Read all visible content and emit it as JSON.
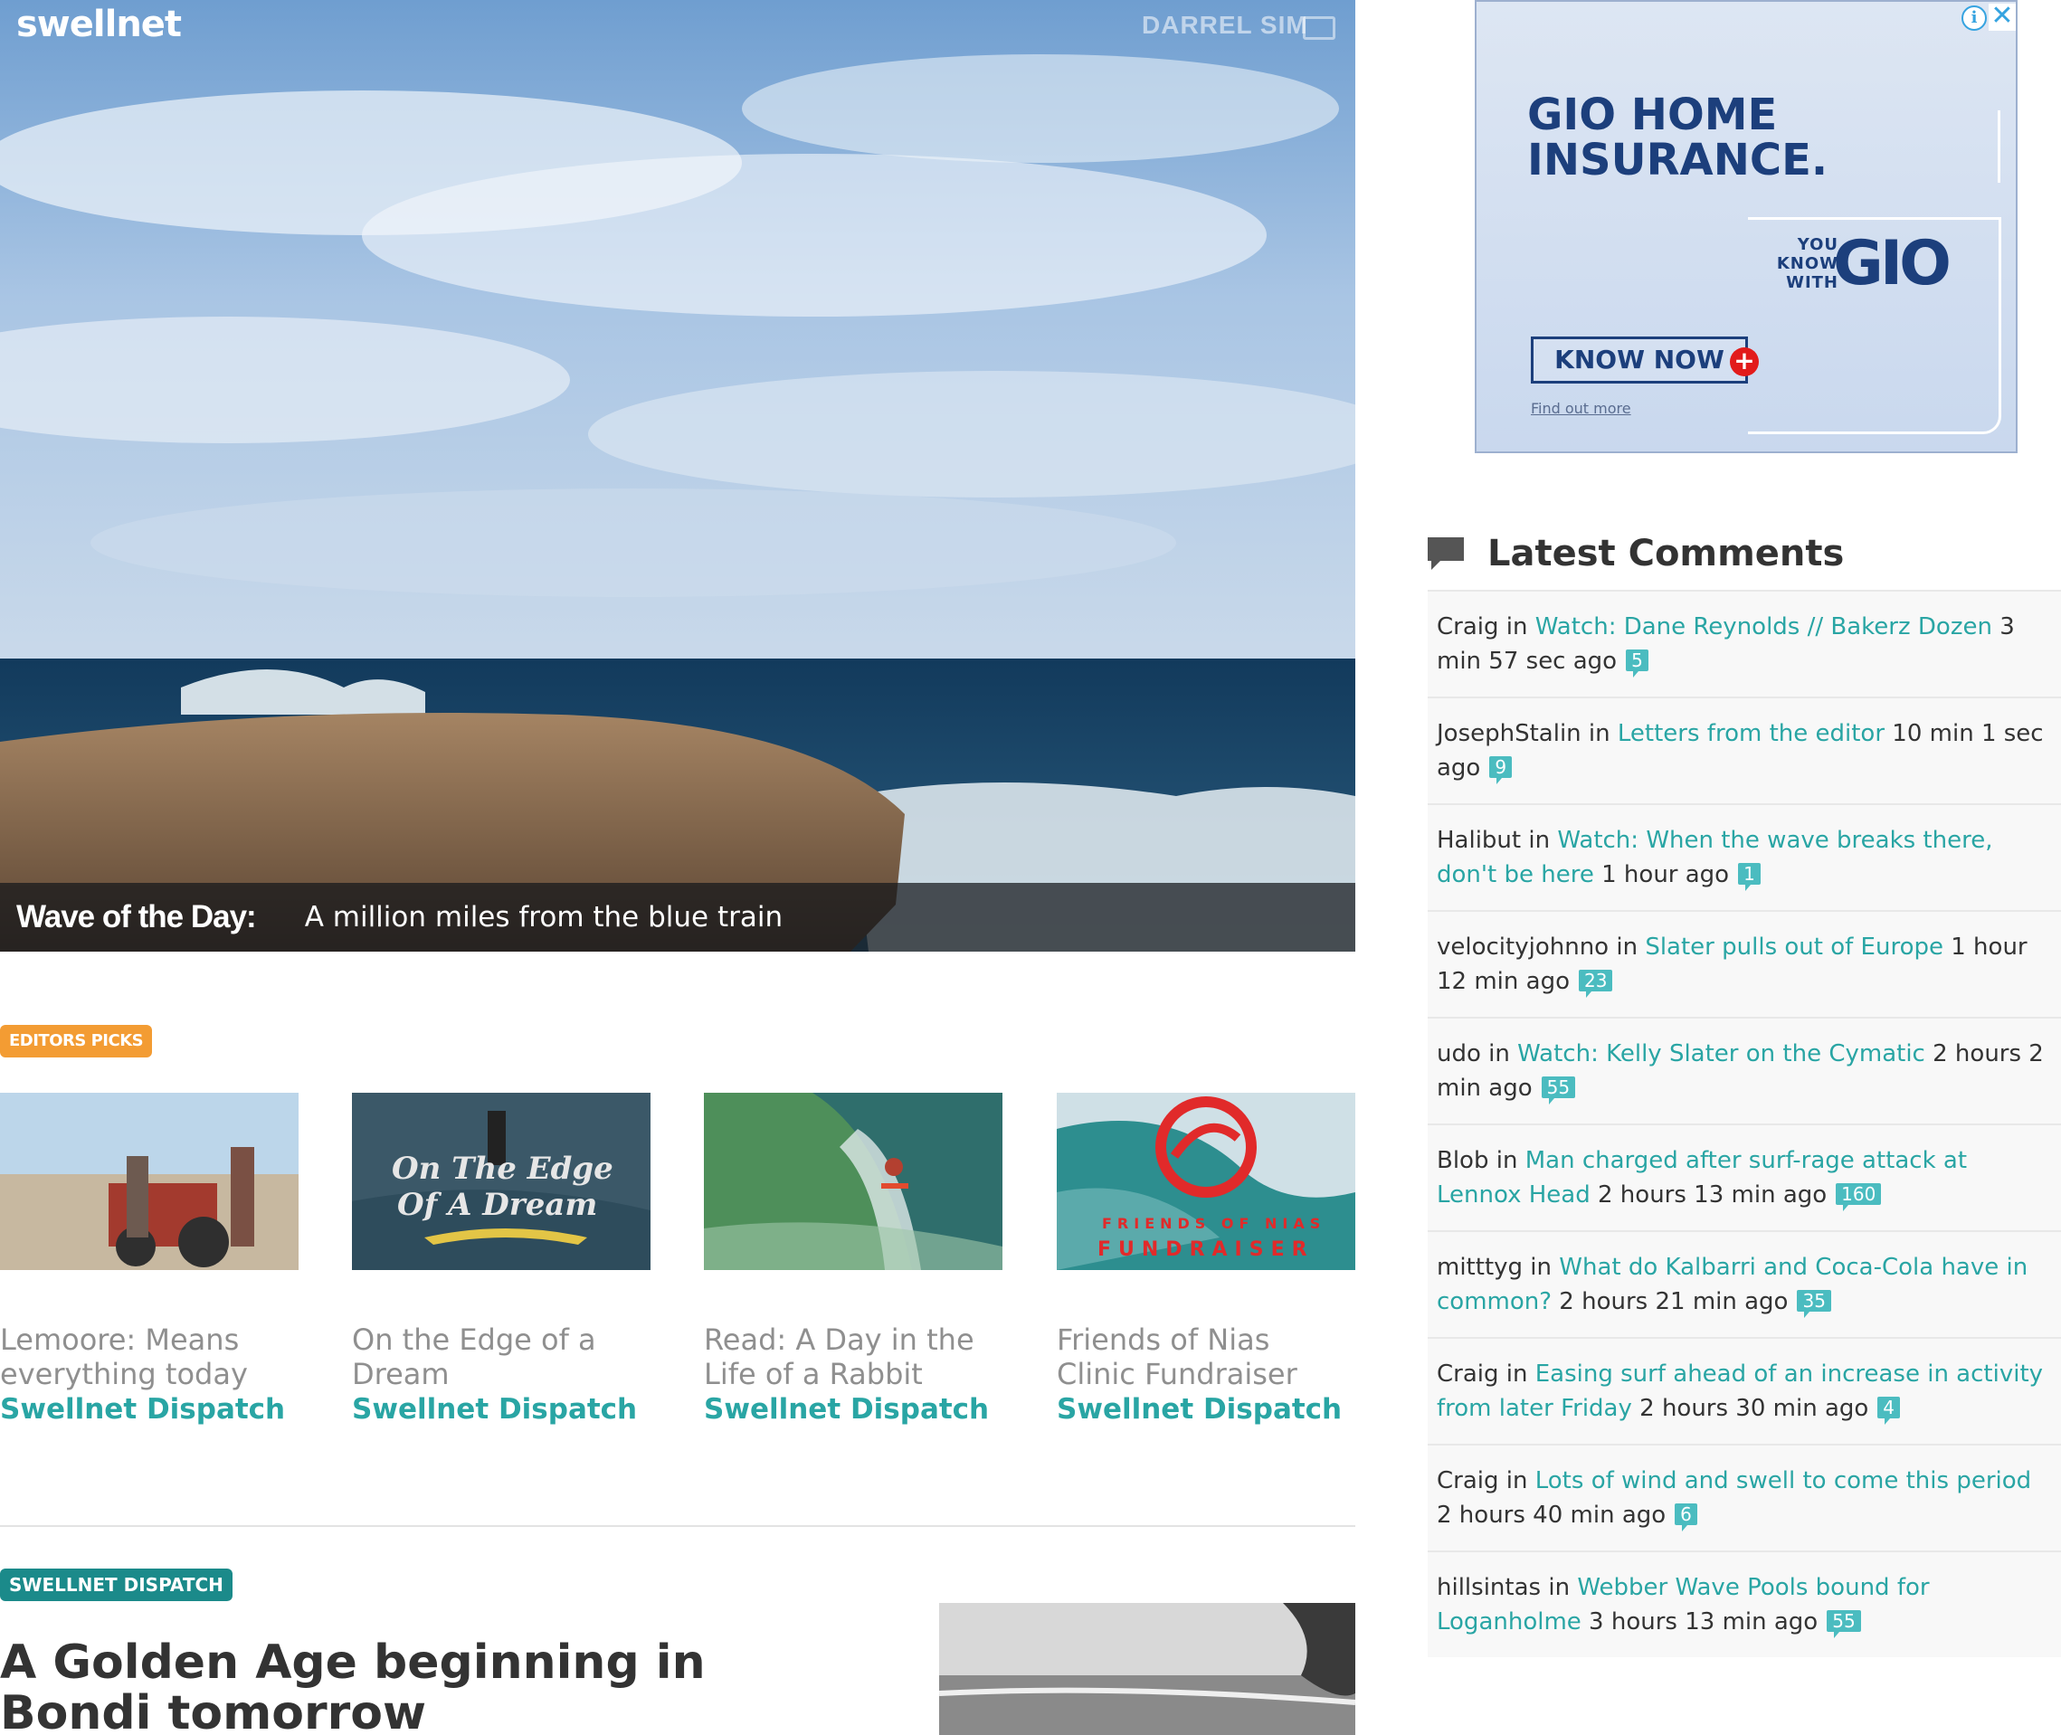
{
  "header": {
    "logo": "swellnet",
    "photo_credit": "DARREL SIM",
    "photo_credit_icon": "camera-icon"
  },
  "hero": {
    "label": "Wave of the Day:",
    "title": "A million miles from the blue train"
  },
  "editors_picks": {
    "badge": "EDITORS PICKS",
    "items": [
      {
        "title": "Lemoore: Means everything today",
        "section": "Swellnet Dispatch"
      },
      {
        "title": "On the Edge of a Dream",
        "section": "Swellnet Dispatch",
        "thumb_text_1": "On The Edge",
        "thumb_text_2": "Of A Dream"
      },
      {
        "title": "Read: A Day in the Life of a Rabbit",
        "section": "Swellnet Dispatch"
      },
      {
        "title": "Friends of Nias Clinic Fundraiser",
        "section": "Swellnet Dispatch",
        "thumb_text_1": "FRIENDS OF NIAS",
        "thumb_text_2": "FUNDRAISER"
      }
    ]
  },
  "article": {
    "badge": "SWELLNET DISPATCH",
    "headline": "A Golden Age beginning in Bondi tomorrow"
  },
  "ad": {
    "title_1": "GIO HOME",
    "title_2": "INSURANCE.",
    "tag_1": "YOU",
    "tag_2": "KNOW",
    "tag_3": "WITH",
    "brand": "GIO",
    "cta": "KNOW NOW",
    "plus": "+",
    "find_out": "Find out more",
    "info": "i",
    "close": "✕",
    "colors": {
      "brand": "#1c3f7c",
      "accent": "#e21b1b"
    }
  },
  "latest_comments": {
    "heading": "Latest Comments",
    "icon": "speech-bubble-icon",
    "items": [
      {
        "user": "Craig",
        "in": " in ",
        "link": "Watch: Dane Reynolds // Bakerz Dozen",
        "time": " 3 min 57 sec ago",
        "count": "5"
      },
      {
        "user": "JosephStalin",
        "in": " in ",
        "link": "Letters from the editor",
        "time": " 10 min 1 sec ago",
        "count": "9"
      },
      {
        "user": "Halibut",
        "in": " in ",
        "link": "Watch: When the wave breaks there, don't be here",
        "time": " 1 hour ago",
        "count": "1"
      },
      {
        "user": "velocityjohnno",
        "in": " in ",
        "link": "Slater pulls out of Europe",
        "time": " 1 hour 12 min ago",
        "count": "23"
      },
      {
        "user": "udo",
        "in": " in ",
        "link": "Watch: Kelly Slater on the Cymatic",
        "time": " 2 hours 2 min ago",
        "count": "55"
      },
      {
        "user": "Blob",
        "in": " in ",
        "link": "Man charged after surf-rage attack at Lennox Head",
        "time": " 2 hours 13 min ago",
        "count": "160"
      },
      {
        "user": "mitttyg",
        "in": " in ",
        "link": "What do Kalbarri and Coca-Cola have in common?",
        "time": " 2 hours 21 min ago",
        "count": "35"
      },
      {
        "user": "Craig",
        "in": " in ",
        "link": "Easing surf ahead of an increase in activity from later Friday",
        "time": " 2 hours 30 min ago",
        "count": "4"
      },
      {
        "user": "Craig",
        "in": " in ",
        "link": "Lots of wind and swell to come this period",
        "time": " 2 hours 40 min ago",
        "count": "6"
      },
      {
        "user": "hillsintas",
        "in": " in ",
        "link": "Webber Wave Pools bound for Loganholme",
        "time": " 3 hours 13 min ago",
        "count": "55"
      }
    ]
  }
}
